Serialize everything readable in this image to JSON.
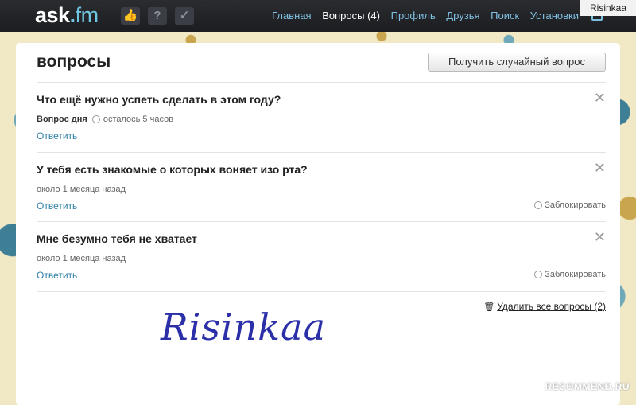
{
  "brand": {
    "logo_main": "ask",
    "logo_dot": ".",
    "logo_fm": "fm"
  },
  "toolbar": {
    "q_icon": "?",
    "check_icon": "✓",
    "thumb_icon": "👍"
  },
  "nav": {
    "items": [
      "Главная",
      "Вопросы (4)",
      "Профиль",
      "Друзья",
      "Поиск",
      "Установки"
    ],
    "active_index": 1
  },
  "watermark": "Risinkaa",
  "page": {
    "title": "вопросы",
    "random_button": "Получить случайный вопрос"
  },
  "questions": [
    {
      "text": "Что ещё нужно успеть сделать в этом году?",
      "tag": "Вопрос дня",
      "time": "осталось 5 часов",
      "answer": "Ответить",
      "block": ""
    },
    {
      "text": "У тебя есть знакомые о которых воняет изо рта?",
      "tag": "",
      "time": "около 1 месяца назад",
      "answer": "Ответить",
      "block": "Заблокировать"
    },
    {
      "text": "Мне безумно тебя не хватает",
      "tag": "",
      "time": "около 1 месяца назад",
      "answer": "Ответить",
      "block": "Заблокировать"
    }
  ],
  "delete_all": "Удалить все вопросы (2)",
  "signature": "Risinkaa",
  "site_watermark": "RECOMMEND.RU",
  "close_glyph": "✕"
}
